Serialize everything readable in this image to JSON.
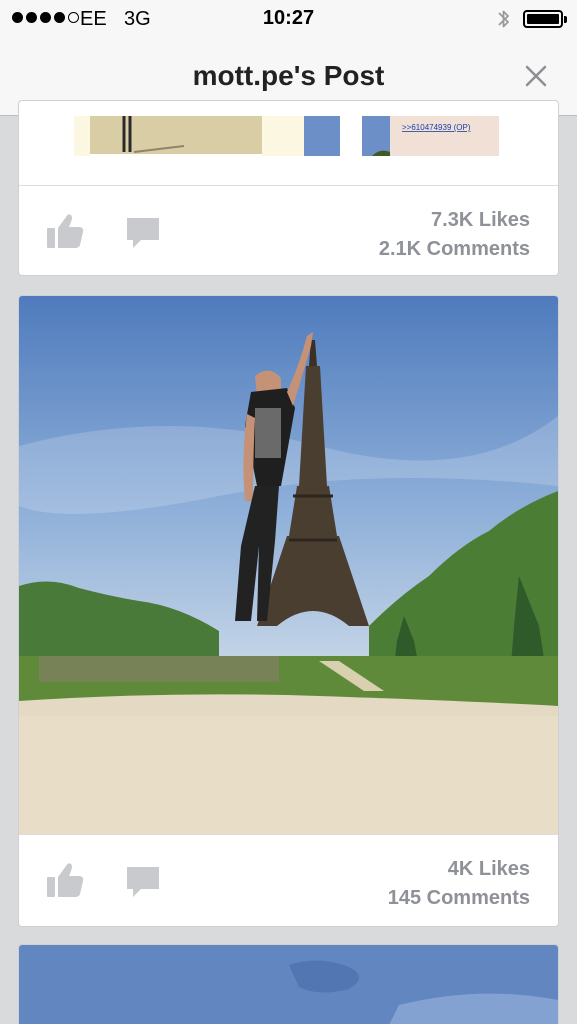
{
  "status_bar": {
    "carrier": "EE",
    "network": "3G",
    "time": "10:27",
    "signal_bars": 4,
    "signal_total": 5,
    "battery_level": 1.0
  },
  "nav": {
    "title": "mott.pe's Post",
    "close_icon": "close-icon"
  },
  "previous_post": {
    "image_caption": ">>610474939 (OP)",
    "likes": "7.3K Likes",
    "comments": "2.1K Comments"
  },
  "post": {
    "likes": "4K Likes",
    "comments": "145 Comments"
  },
  "icons": {
    "like": "thumbs-up-icon",
    "comment": "comment-bubble-icon",
    "bluetooth": "bluetooth-icon",
    "battery": "battery-icon"
  },
  "colors": {
    "icon_gray": "#c9cacd",
    "count_text": "#8e9197",
    "sky": "#5b86c4",
    "grass": "#5f8a3a"
  }
}
